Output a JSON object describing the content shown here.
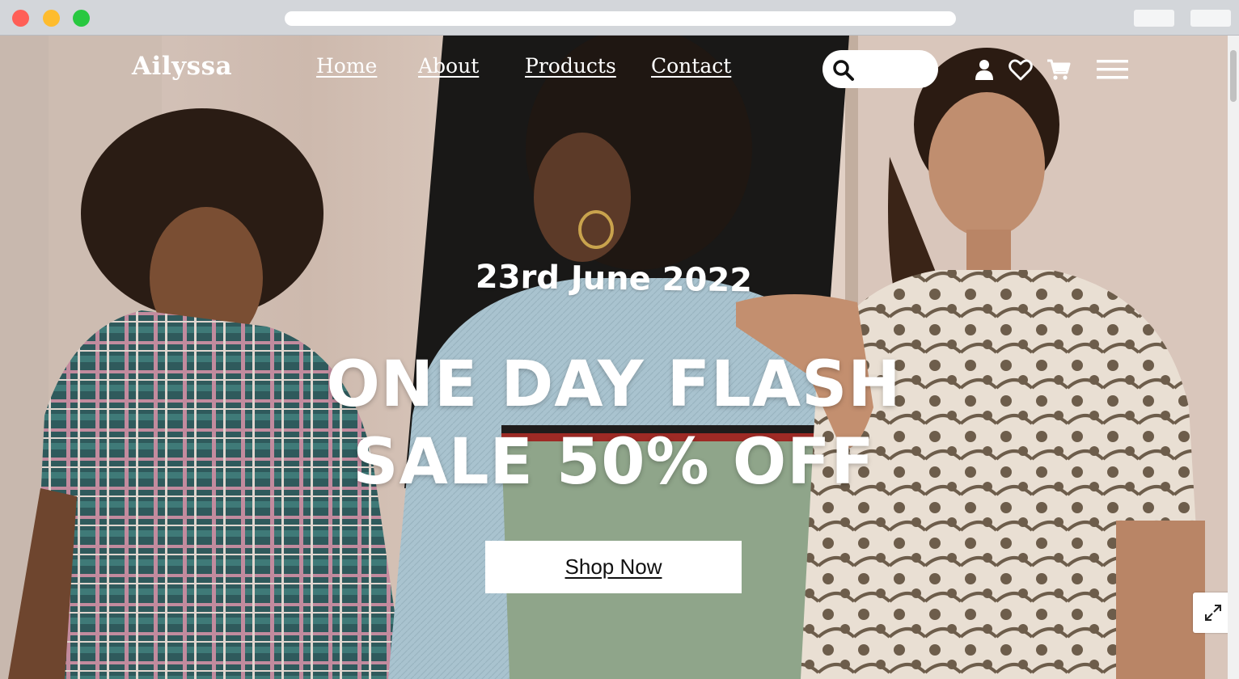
{
  "browser": {
    "window_controls": [
      "close",
      "minimize",
      "maximize"
    ]
  },
  "nav": {
    "logo": "Ailyssa",
    "links": [
      {
        "label": "Home"
      },
      {
        "label": "About"
      },
      {
        "label": "Products"
      },
      {
        "label": "Contact"
      }
    ],
    "search": {
      "value": "",
      "placeholder": ""
    },
    "icons": [
      "search-icon",
      "user-icon",
      "heart-icon",
      "cart-icon",
      "menu-icon"
    ]
  },
  "hero": {
    "date": "23rd June 2022",
    "headline_line1": "ONE DAY FLASH",
    "headline_line2": "SALE 50% OFF",
    "cta": "Shop Now"
  },
  "colors": {
    "text": "#ffffff",
    "button_bg": "#ffffff",
    "button_text": "#111111"
  }
}
